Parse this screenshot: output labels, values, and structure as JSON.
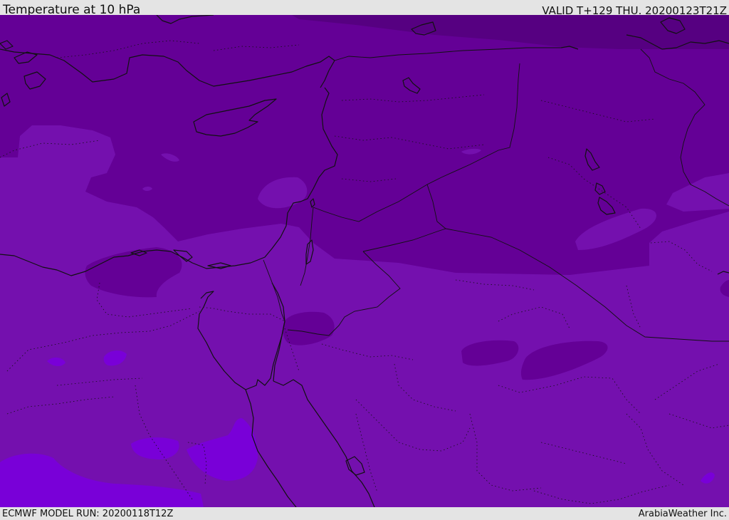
{
  "header": {
    "title": "Temperature at 10 hPa",
    "valid_time": "VALID T+129 THU. 20200123T21Z"
  },
  "footer": {
    "model_run": "ECMWF MODEL RUN: 20200118T12Z",
    "credit": "ArabiaWeather Inc."
  },
  "map": {
    "colors": {
      "darkest": "#560081",
      "dark": "#640096",
      "medium": "#7410ae",
      "light": "#7900d8",
      "border": "#111111"
    }
  }
}
